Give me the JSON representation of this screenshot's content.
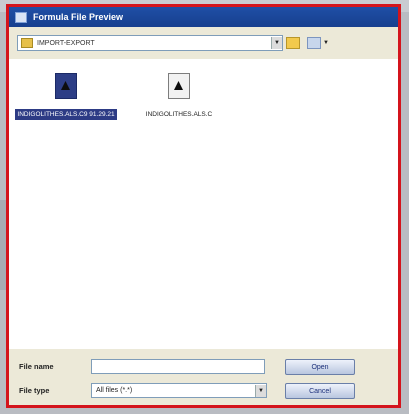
{
  "dialog": {
    "title": "Formula File Preview",
    "path": "IMPORT-EXPORT",
    "accent_color": "#d4141c"
  },
  "toolbar": {
    "up_icon": "folder-up-icon",
    "view_icon": "view-menu-icon"
  },
  "files": [
    {
      "name": "INDIGOLITHES.ALS.C9 91.29.21",
      "icon": "formula-file-icon",
      "selected": true
    },
    {
      "name": "INDIGOLITHES.ALS.C",
      "icon": "formula-file-icon",
      "selected": false
    }
  ],
  "footer": {
    "file_name_label": "File name",
    "file_name_value": "",
    "file_type_label": "File type",
    "file_type_value": "All files (*.*)",
    "open_label": "Open",
    "cancel_label": "Cancel"
  }
}
